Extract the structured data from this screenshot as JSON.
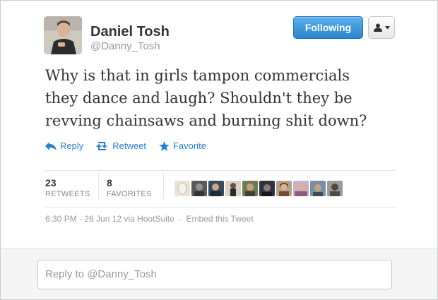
{
  "user": {
    "name": "Daniel Tosh",
    "handle": "@Danny_Tosh"
  },
  "header": {
    "follow_label": "Following"
  },
  "tweet": {
    "text_lines": [
      "Why is that in girls tampon commercials",
      "they dance and laugh? Shouldn't they be",
      "revving chainsaws and burning shit down?"
    ]
  },
  "actions": {
    "reply": "Reply",
    "retweet": "Retweet",
    "favorite": "Favorite"
  },
  "stats": {
    "retweets_count": "23",
    "retweets_label": "RETWEETS",
    "favorites_count": "8",
    "favorites_label": "FAVORITES"
  },
  "meta": {
    "timestamp": "6:30 PM - 26 Jun 12",
    "via": "via HootSuite",
    "separator": "·",
    "embed": "Embed this Tweet"
  },
  "reply_box": {
    "placeholder": "Reply to @Danny_Tosh"
  },
  "colors": {
    "link": "#2a7fc5",
    "follow_button": "#2b85cf"
  },
  "icons": {
    "reply": "reply-arrow-icon",
    "retweet": "retweet-icon",
    "favorite": "star-icon",
    "user_menu": "person-icon"
  }
}
